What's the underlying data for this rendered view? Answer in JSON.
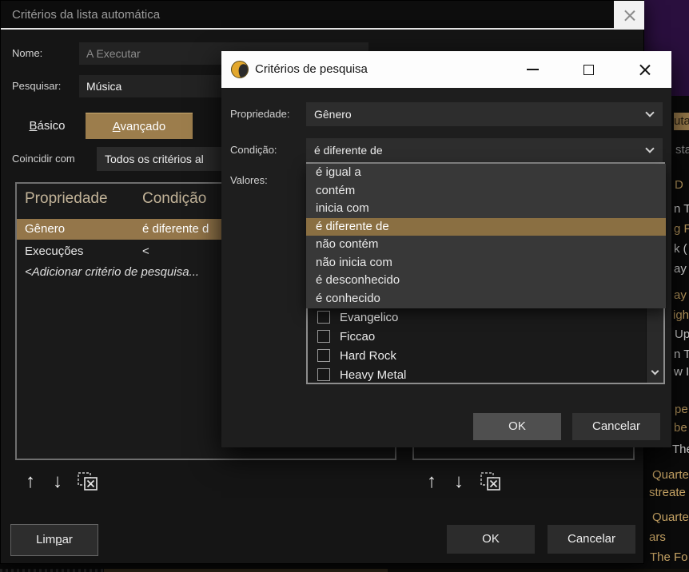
{
  "colors": {
    "accent_tan": "#9c7d4c",
    "selection_tan": "#8a6f42",
    "front_titlebar_bg": "#fdfdfd",
    "dialog_bg": "#1e1e1e",
    "back_dialog_bg": "#151515",
    "background_purple": "#2a0f3e"
  },
  "autolist_dialog": {
    "title": "Critérios da lista automática",
    "nome_label": "Nome:",
    "nome_value": "A Executar",
    "pesquisar_label": "Pesquisar:",
    "pesquisar_value": "Música",
    "tabs": [
      "Básico",
      "Avançado"
    ],
    "match_label": "Coincidir com",
    "match_value": "Todos os critérios al",
    "table": {
      "headers": [
        "Propriedade",
        "Condição"
      ],
      "rows": [
        {
          "property": "Gênero",
          "condition": "é diferente d"
        },
        {
          "property": "Execuções",
          "condition": "<"
        },
        {
          "property": "<Adicionar critério de pesquisa...",
          "condition": ""
        }
      ]
    },
    "buttons": {
      "limpar": "Limpar",
      "ok": "OK",
      "cancelar": "Cancelar"
    }
  },
  "search_dialog": {
    "title": "Critérios de pesquisa",
    "property_label": "Propriedade:",
    "property_value": "Gênero",
    "condition_label": "Condição:",
    "condition_value": "é diferente de",
    "values_label": "Valores:",
    "condition_options": [
      "é igual a",
      "contém",
      "inicia com",
      "é diferente de",
      "não contém",
      "não inicia com",
      "é desconhecido",
      "é conhecido"
    ],
    "selected_option": "é diferente de",
    "value_items": [
      "Evangelico",
      "Ficcao",
      "Hard Rock",
      "Heavy Metal"
    ],
    "buttons": {
      "ok": "OK",
      "cancelar": "Cancelar"
    }
  },
  "background": {
    "fragments": [
      "uta",
      "sta",
      "D",
      "n T",
      "g F",
      "k (",
      "ay",
      "ay",
      "igh",
      "Up",
      "n T",
      "w I",
      "pe",
      "be",
      "The",
      "Quarte",
      "streate",
      "Quarte",
      "ars",
      "The Fo"
    ]
  }
}
